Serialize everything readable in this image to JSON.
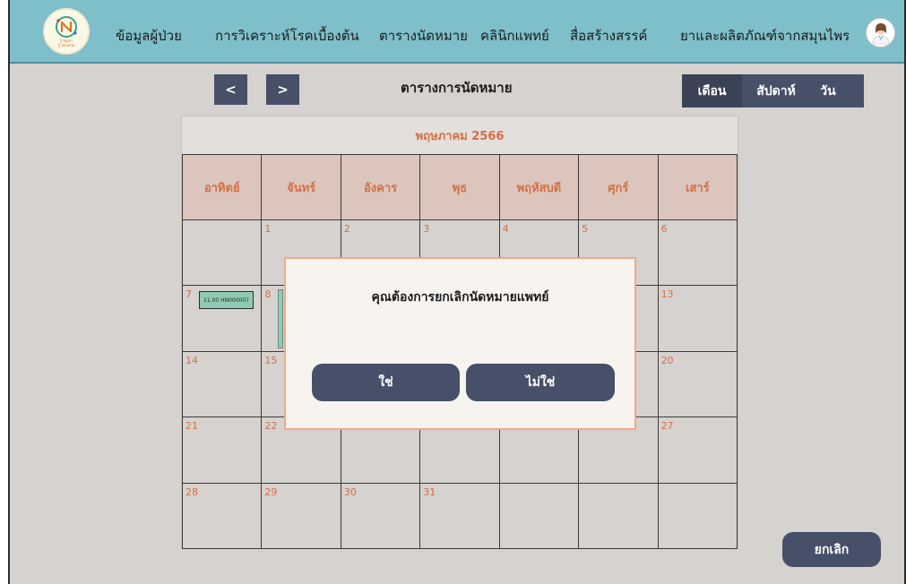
{
  "header": {
    "logo_text_line1": "รู้ ปัญหา",
    "logo_text_line2": "รู้ ปลอดภัย",
    "nav_items": [
      "ข้อมูลผู้ป่วย",
      "การวิเคราะห์โรคเบื้องต้น",
      "ตารางนัดหมาย",
      "คลินิกแพทย์",
      "สื่อสร้างสรรค์",
      "ยาและผลิตภัณฑ์จากสมุนไพร"
    ]
  },
  "toolbar": {
    "prev_label": "<",
    "next_label": ">",
    "title": "ตารางการนัดหมาย",
    "views": [
      "เดือน",
      "สัปดาห์",
      "วัน"
    ],
    "active_view": "เดือน"
  },
  "calendar": {
    "month": "พฤษภาคม 2566",
    "weekdays": [
      "อาทิตย์",
      "จันทร์",
      "อังคาร",
      "พุธ",
      "พฤหัสบดี",
      "ศุกร์",
      "เสาร์"
    ],
    "days": [
      "",
      "1",
      "2",
      "3",
      "4",
      "5",
      "6",
      "7",
      "8",
      "",
      "",
      "",
      "",
      "13",
      "14",
      "15",
      "",
      "",
      "",
      "",
      "20",
      "21",
      "22",
      "",
      "",
      "",
      "",
      "27",
      "28",
      "29",
      "30",
      "31",
      "",
      "",
      ""
    ],
    "appointment": "11.00 HN000007"
  },
  "modal": {
    "message": "คุณต้องการยกเลิกนัดหมายแพทย์",
    "yes_label": "ใช่",
    "no_label": "ไม่ใช่"
  },
  "footer": {
    "cancel_label": "ยกเลิก"
  },
  "colors": {
    "header_bg": "#7ebfc9",
    "button_bg": "#465068",
    "accent_text": "#d47045",
    "modal_border": "#f0a98a"
  }
}
